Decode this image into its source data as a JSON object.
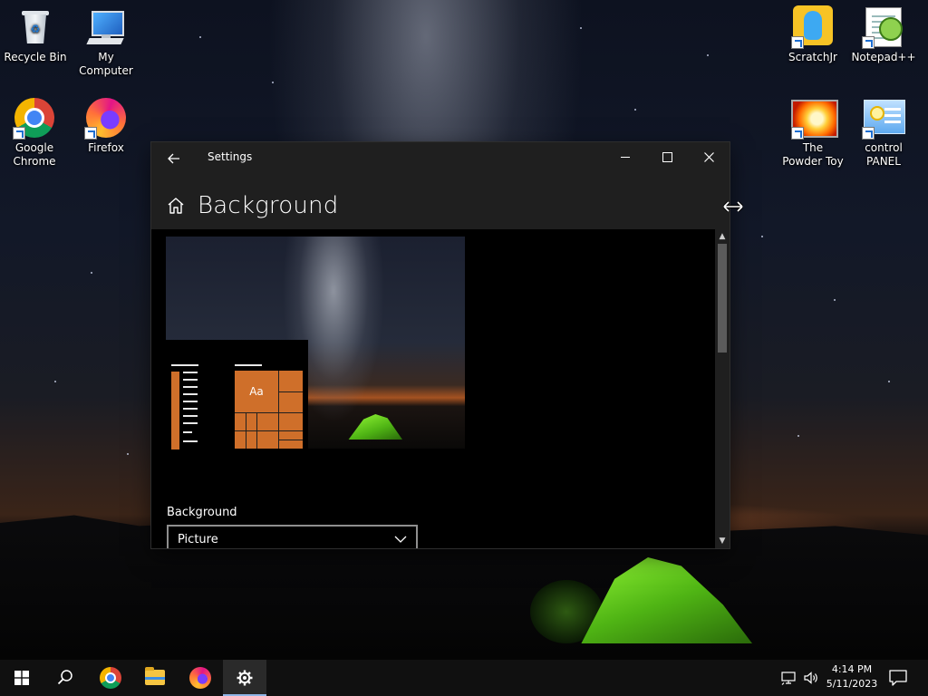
{
  "desktop": {
    "icons": [
      {
        "label": "Recycle Bin",
        "icon": "recycle-bin-icon"
      },
      {
        "label": "My Computer",
        "icon": "computer-icon"
      },
      {
        "label": "Google Chrome",
        "icon": "chrome-icon"
      },
      {
        "label": "Firefox",
        "icon": "firefox-icon"
      },
      {
        "label": "ScratchJr",
        "icon": "scratchjr-icon"
      },
      {
        "label": "Notepad++",
        "icon": "notepadpp-icon"
      },
      {
        "label": "The Powder Toy",
        "icon": "powder-toy-icon"
      },
      {
        "label": "control PANEL",
        "icon": "control-panel-icon"
      }
    ]
  },
  "window": {
    "title": "Settings",
    "back_icon": "arrow-left-icon",
    "controls": {
      "minimize": "minimize-icon",
      "maximize": "maximize-icon",
      "close": "close-icon"
    },
    "page": {
      "title": "Background",
      "home_icon": "home-icon",
      "preview": {
        "sample_text": "Aa"
      },
      "background_section": {
        "label": "Background",
        "selected": "Picture"
      }
    }
  },
  "taskbar": {
    "items": [
      "start-icon",
      "search-icon",
      "chrome-icon",
      "file-explorer-icon",
      "firefox-icon",
      "settings-gear-icon"
    ],
    "active": "settings-gear-icon",
    "tray": {
      "time": "4:14 PM",
      "date": "5/11/2023"
    }
  },
  "colors": {
    "accent": "#cf6f2a",
    "window_bg": "#1f1f1f",
    "taskbar_bg": "#101010"
  }
}
